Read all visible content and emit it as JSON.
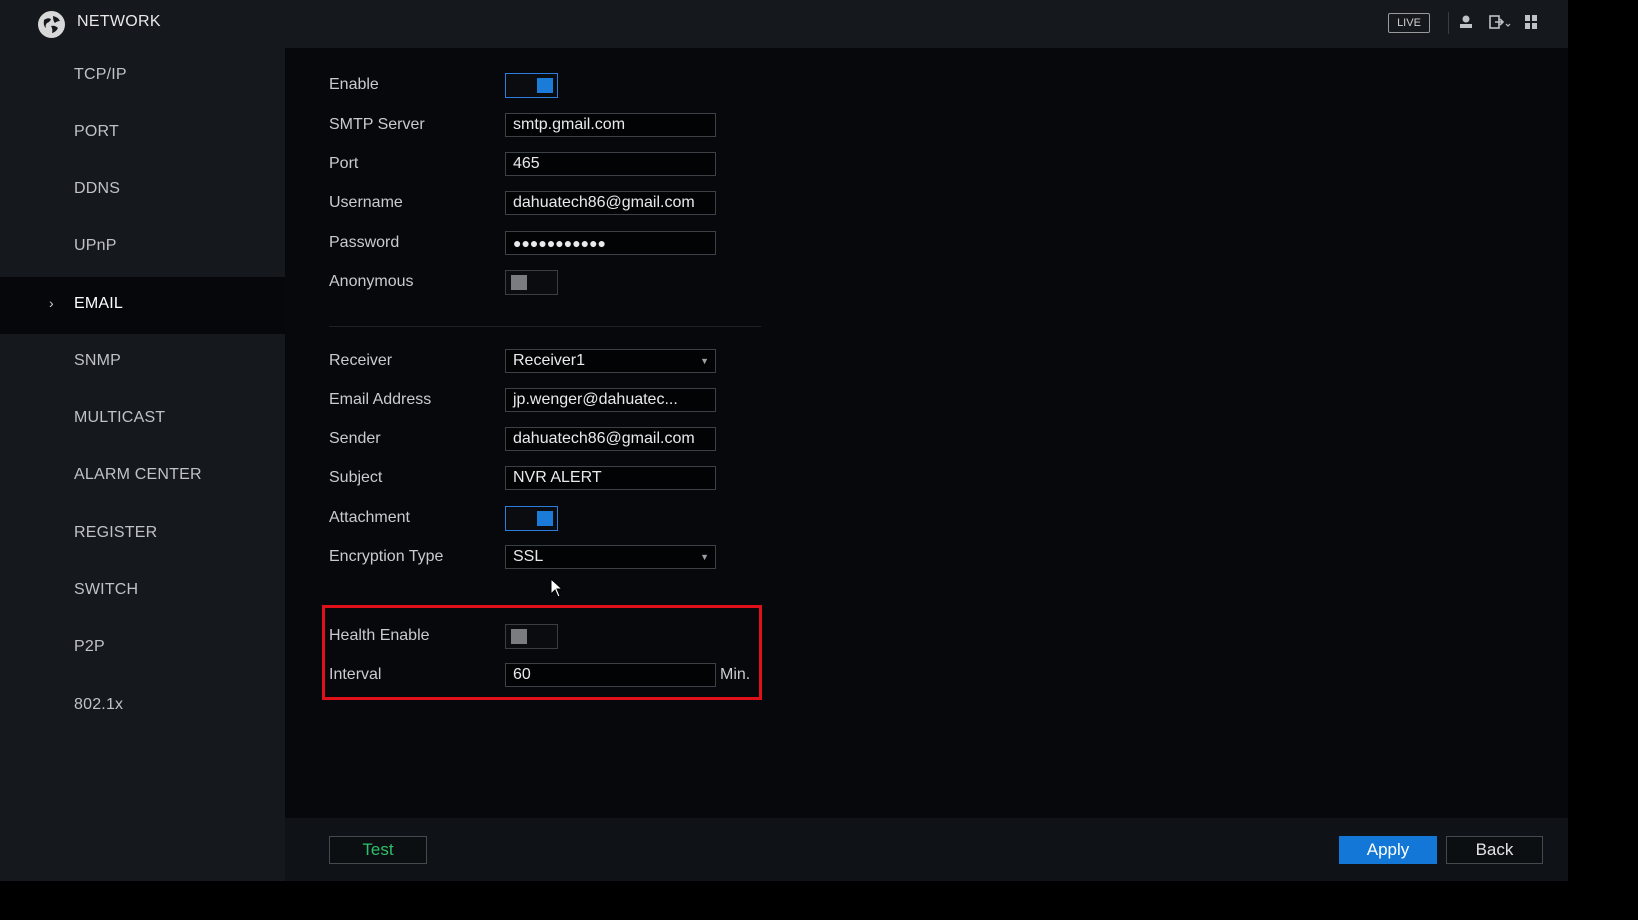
{
  "header": {
    "title": "NETWORK",
    "live_label": "LIVE",
    "icons": [
      "globe-logo-icon",
      "user-icon",
      "logout-icon",
      "grid-icon"
    ]
  },
  "sidebar": {
    "items": [
      {
        "label": "TCP/IP"
      },
      {
        "label": "PORT"
      },
      {
        "label": "DDNS"
      },
      {
        "label": "UPnP"
      },
      {
        "label": "EMAIL",
        "active": true
      },
      {
        "label": "SNMP"
      },
      {
        "label": "MULTICAST"
      },
      {
        "label": "ALARM CENTER"
      },
      {
        "label": "REGISTER"
      },
      {
        "label": "SWITCH"
      },
      {
        "label": "P2P"
      },
      {
        "label": "802.1x"
      }
    ],
    "active_indicator": "›"
  },
  "form": {
    "enable": {
      "label": "Enable",
      "value": true
    },
    "smtp_server": {
      "label": "SMTP Server",
      "value": "smtp.gmail.com"
    },
    "port": {
      "label": "Port",
      "value": "465"
    },
    "username": {
      "label": "Username",
      "value": "dahuatech86@gmail.com"
    },
    "password": {
      "label": "Password",
      "value": "●●●●●●●●●●●"
    },
    "anonymous": {
      "label": "Anonymous",
      "value": false
    },
    "receiver": {
      "label": "Receiver",
      "value": "Receiver1"
    },
    "email_address": {
      "label": "Email Address",
      "value": "jp.wenger@dahuatec..."
    },
    "sender": {
      "label": "Sender",
      "value": "dahuatech86@gmail.com"
    },
    "subject": {
      "label": "Subject",
      "value": "NVR ALERT"
    },
    "attachment": {
      "label": "Attachment",
      "value": true
    },
    "encryption_type": {
      "label": "Encryption Type",
      "value": "SSL"
    },
    "health_enable": {
      "label": "Health Enable",
      "value": false
    },
    "interval": {
      "label": "Interval",
      "value": "60",
      "unit": "Min."
    }
  },
  "footer": {
    "test_label": "Test",
    "apply_label": "Apply",
    "back_label": "Back"
  },
  "colors": {
    "accent": "#1277d6",
    "highlight": "#e0101a",
    "test_text": "#2fbf6a"
  }
}
